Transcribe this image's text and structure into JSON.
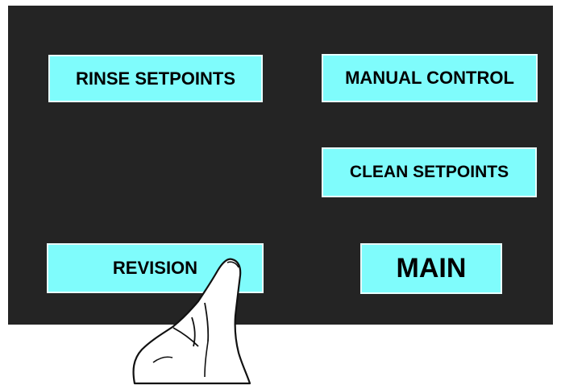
{
  "buttons": {
    "rinse_setpoints": "RINSE SETPOINTS",
    "manual_control": "MANUAL CONTROL",
    "clean_setpoints": "CLEAN SETPOINTS",
    "revision": "REVISION",
    "main": "MAIN"
  },
  "colors": {
    "panel_background": "#242424",
    "button_fill": "#7ffcfc",
    "button_border": "#e9ffff",
    "button_text": "#000000",
    "page_background": "#ffffff"
  },
  "icons": {
    "pointer": "pointing-hand-icon"
  }
}
